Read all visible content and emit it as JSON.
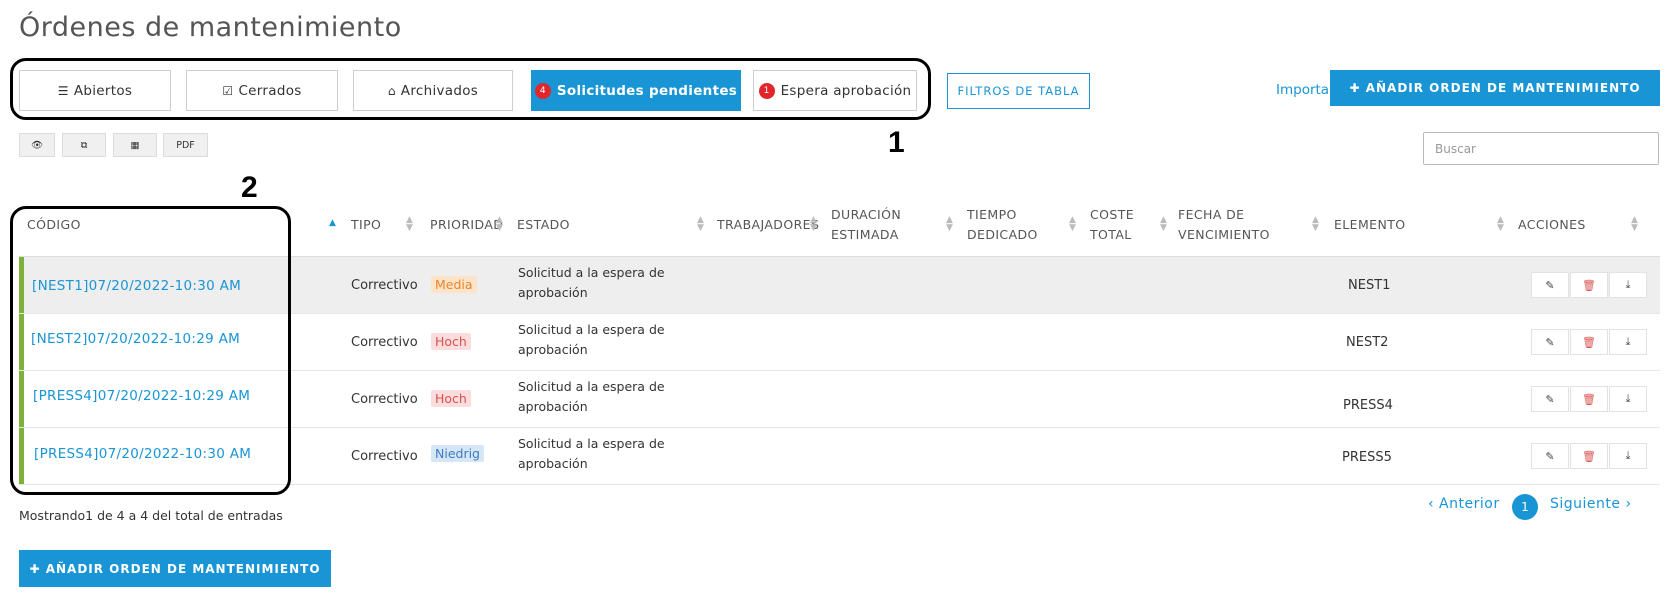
{
  "page": {
    "title": "Órdenes de mantenimiento"
  },
  "tabs": [
    {
      "label": "Abiertos",
      "icon": "list-icon"
    },
    {
      "label": "Cerrados",
      "icon": "check-square-icon"
    },
    {
      "label": "Archivados",
      "icon": "inbox-icon"
    },
    {
      "label": "Solicitudes pendientes",
      "count": "4",
      "active": true
    },
    {
      "label": "Espera aprobación",
      "count": "1"
    }
  ],
  "toolbar": {
    "table_filters_label": "FILTROS DE TABLA",
    "import_label": "Importar",
    "add_order_label": "✚ AÑADIR ORDEN DE MANTENIMIENTO",
    "pdf_label": "PDF",
    "search_placeholder": "Buscar"
  },
  "annotations": {
    "box1": "1",
    "box2": "2"
  },
  "table": {
    "headers": {
      "codigo": "CÓDIGO",
      "tipo": "TIPO",
      "prioridad": "PRIORIDAD",
      "estado": "ESTADO",
      "trabajadores": "TRABAJADORES",
      "duracion": [
        "DURACIÓN",
        "ESTIMADA"
      ],
      "tiempo": [
        "TIEMPO",
        "DEDICADO"
      ],
      "coste": [
        "COSTE",
        "TOTAL"
      ],
      "fecha": [
        "FECHA DE",
        "VENCIMIENTO"
      ],
      "elemento": "ELEMENTO",
      "acciones": "ACCIONES"
    },
    "rows": [
      {
        "code": "[NEST1]07/20/2022-10:30 AM",
        "tipo": "Correctivo",
        "prioridad": "Media",
        "estado": [
          "Solicitud a la espera de",
          "aprobación"
        ],
        "elemento": "NEST1"
      },
      {
        "code": "[NEST2]07/20/2022-10:29 AM",
        "tipo": "Correctivo",
        "prioridad": "Hoch",
        "estado": [
          "Solicitud a la espera de",
          "aprobación"
        ],
        "elemento": "NEST2"
      },
      {
        "code": "[PRESS4]07/20/2022-10:29 AM",
        "tipo": "Correctivo",
        "prioridad": "Hoch",
        "estado": [
          "Solicitud a la espera de",
          "aprobación"
        ],
        "elemento": "PRESS4"
      },
      {
        "code": "[PRESS4]07/20/2022-10:30 AM",
        "tipo": "Correctivo",
        "prioridad": "Niedrig",
        "estado": [
          "Solicitud a la espera de",
          "aprobación"
        ],
        "elemento": "PRESS5"
      }
    ]
  },
  "footer": {
    "info": "Mostrando1 de 4 a 4 del total de entradas",
    "prev_label": "‹ Anterior",
    "current_page": "1",
    "next_label": "Siguiente ›"
  },
  "colors": {
    "accent": "#1995d6",
    "row_bar": "#7db13b",
    "badge_count": "#e0262b"
  }
}
